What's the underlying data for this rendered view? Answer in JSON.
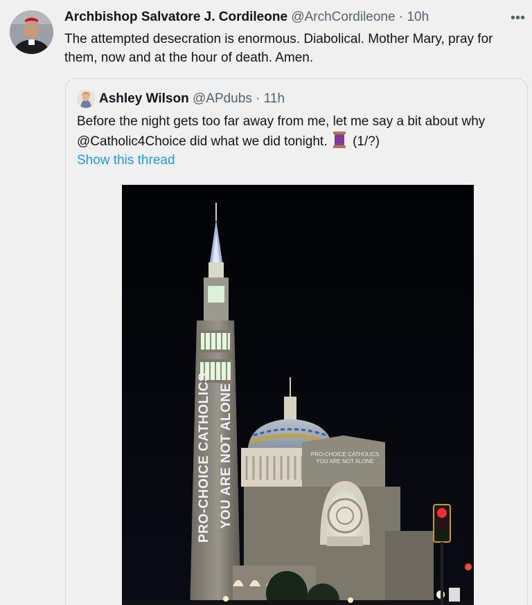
{
  "tweet": {
    "author_name": "Archbishop Salvatore J. Cordileone",
    "author_handle": "@ArchCordileone",
    "separator": "·",
    "time": "10h",
    "more_label": "•••",
    "text": "The attempted desecration is enormous. Diabolical. Mother Mary, pray for them, now and at the hour of death.  Amen."
  },
  "quoted": {
    "author_name": "Ashley Wilson",
    "author_handle": "@APdubs",
    "separator": "·",
    "time": "11h",
    "text_before": "Before the night gets too far away from me, let me say a bit about why @Catholic4Choice did what we did tonight.",
    "emoji_icon": "spool-of-thread-icon",
    "text_after": "(1/?)",
    "show_thread": "Show this thread",
    "image": {
      "projection_tower_line1": "PRO-CHOICE CATHOLICS",
      "projection_tower_line2": "YOU ARE NOT ALONE",
      "projection_facade_line1": "PRO-CHOICE CATHOLICS",
      "projection_facade_line2": "YOU ARE NOT ALONE"
    }
  },
  "colors": {
    "background": "#f0f0f0",
    "text": "#0f1419",
    "secondary": "#536471",
    "link": "#1d9bf0",
    "border": "#cfd9de"
  }
}
